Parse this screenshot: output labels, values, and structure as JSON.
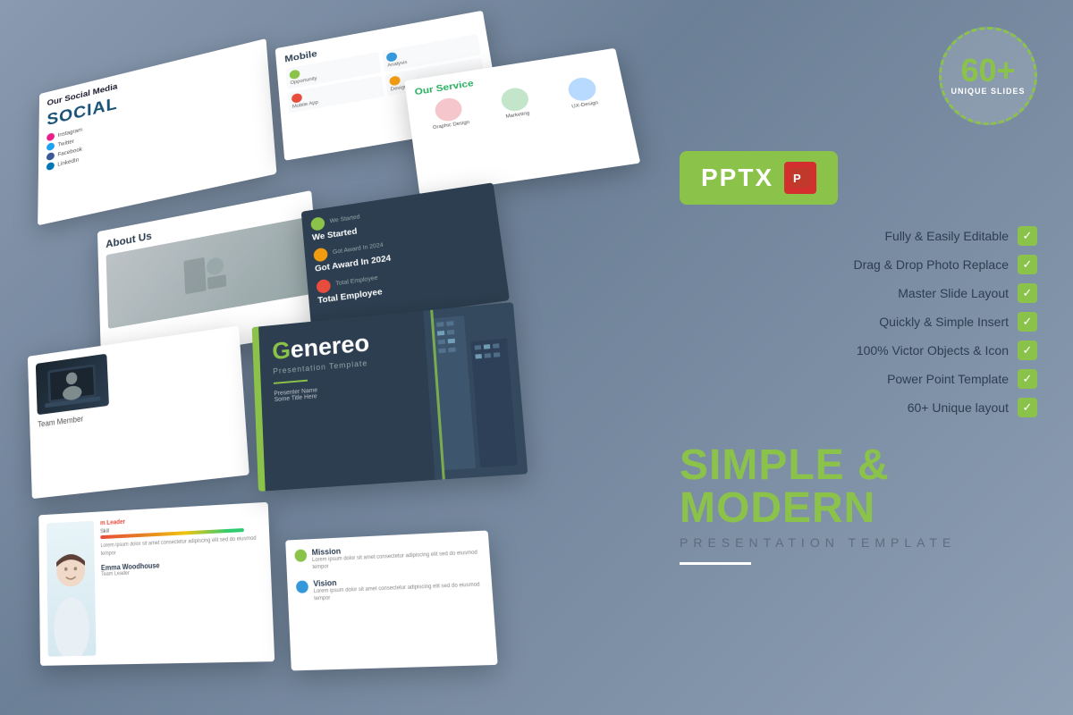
{
  "badge": {
    "number": "60+",
    "label": "UNIQUE SLIDES"
  },
  "pptx": {
    "label": "PPTX",
    "icon_text": "P"
  },
  "features": [
    {
      "label": "Fully & Easily Editable"
    },
    {
      "label": "Drag & Drop Photo Replace"
    },
    {
      "label": "Master Slide Layout"
    },
    {
      "label": "Quickly & Simple Insert"
    },
    {
      "label": "100% Victor Objects & Icon"
    },
    {
      "label": "Power Point Template"
    },
    {
      "label": "60+ Unique layout"
    }
  ],
  "main_title": "SIMPLE & MODERN",
  "sub_title": "PRESENTATION   TEMPLATE",
  "slides": {
    "social_title": "Our Social Media",
    "social_word": "SOCIAL",
    "mobile_title": "Mobile",
    "service_title": "Our Service",
    "about_title": "About Us",
    "hero_title_g": "G",
    "hero_title_rest": "enereo",
    "hero_subtitle": "Presentation Template",
    "leader_name": "Emma Woodhouse",
    "leader_role": "Team Leader",
    "leader_skill_label": "Skill",
    "mission_label": "Mission",
    "vision_label": "Vision"
  },
  "colors": {
    "accent_green": "#8bc34a",
    "dark_slate": "#2c3e50",
    "light_bg": "#f5f5f5",
    "text_dark": "#2c3e50"
  }
}
